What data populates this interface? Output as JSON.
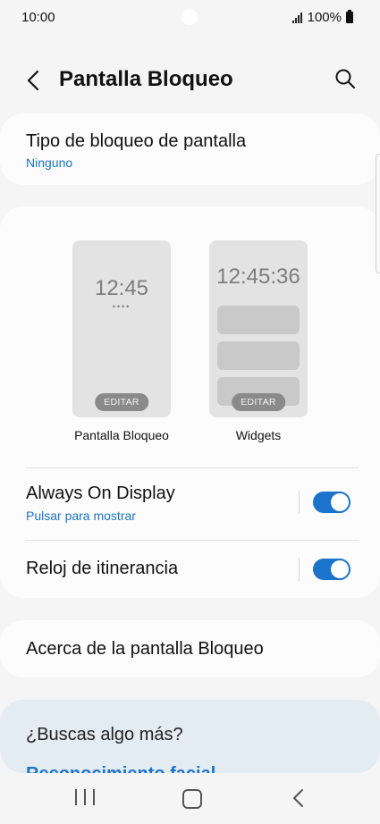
{
  "status_bar": {
    "time": "10:00",
    "battery": "100%"
  },
  "header": {
    "title": "Pantalla Bloqueo"
  },
  "lock_type": {
    "title": "Tipo de bloqueo de pantalla",
    "value": "Ninguno"
  },
  "previews": {
    "lock": {
      "clock": "12:45",
      "dots": "••••",
      "edit": "EDITAR",
      "label": "Pantalla Bloqueo"
    },
    "widgets": {
      "clock": "12:45:36",
      "edit": "EDITAR",
      "label": "Widgets"
    }
  },
  "always_on": {
    "title": "Always On Display",
    "subtitle": "Pulsar para mostrar",
    "enabled": true
  },
  "roaming_clock": {
    "title": "Reloj de itinerancia",
    "enabled": true
  },
  "about": {
    "title": "Acerca de la pantalla Bloqueo"
  },
  "more": {
    "title": "¿Buscas algo más?",
    "link": "Reconocimiento facial"
  },
  "colors": {
    "accent": "#1b73cc",
    "link": "#1a73c8",
    "card": "#fcfcfc",
    "background": "#f5f5f5",
    "more_card": "#e3ebf3"
  },
  "icons": [
    "back-arrow-icon",
    "search-icon",
    "recent-apps-icon",
    "home-icon",
    "nav-back-icon"
  ]
}
